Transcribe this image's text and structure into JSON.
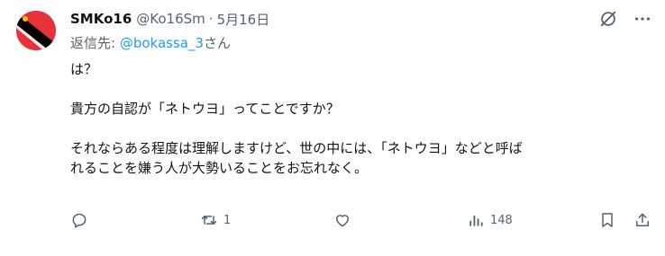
{
  "tweet": {
    "author_name": "SMKo16",
    "handle": "@Ko16Sm",
    "separator": "·",
    "date": "5月16日",
    "reply_prefix": "返信先: ",
    "reply_mention": "@bokassa_3",
    "reply_suffix": "さん",
    "body": [
      "は？",
      "貴方の自認が「ネトウヨ」ってことですか？",
      "それならある程度は理解しますけど、世の中には、「ネトウヨ」などと呼ば",
      "れることを嫌う人が大勢いることをお忘れなく。"
    ]
  },
  "actions": {
    "reply_count": "",
    "retweet_count": "1",
    "like_count": "",
    "views_count": "148"
  },
  "colors": {
    "text": "#0f1419",
    "muted": "#536471",
    "link": "#1d9bf0",
    "avatar_red": "#e8313a",
    "avatar_black": "#000000",
    "avatar_yellow": "#f2c200"
  },
  "icons": [
    "grok-icon",
    "more-icon",
    "reply-icon",
    "retweet-icon",
    "like-icon",
    "views-icon",
    "bookmark-icon",
    "share-icon"
  ]
}
